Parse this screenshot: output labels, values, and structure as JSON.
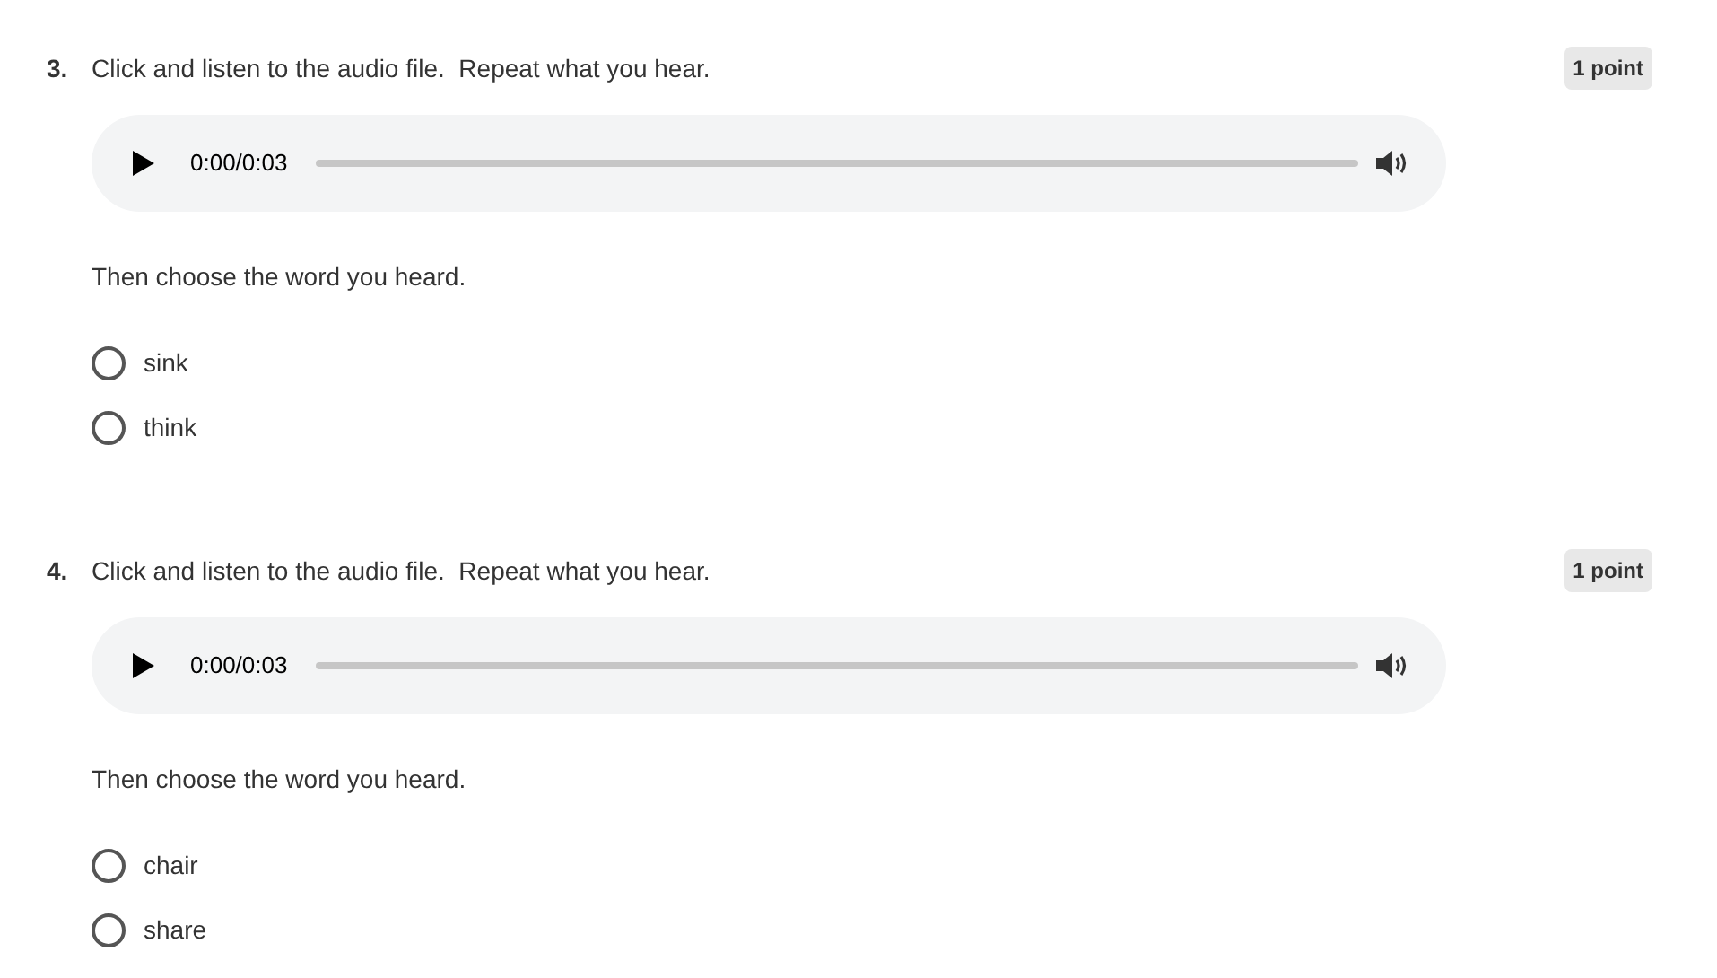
{
  "questions": [
    {
      "number": "3.",
      "text": "Click and listen to the audio file.  Repeat what you hear.",
      "points": "1 point",
      "audio": {
        "time": "0:00/0:03"
      },
      "prompt": "Then choose the word you heard.",
      "options": [
        {
          "label": "sink",
          "selected": false
        },
        {
          "label": "think",
          "selected": false
        }
      ]
    },
    {
      "number": "4.",
      "text": "Click and listen to the audio file.  Repeat what you hear.",
      "points": "1 point",
      "audio": {
        "time": "0:00/0:03"
      },
      "prompt": "Then choose the word you heard.",
      "options": [
        {
          "label": "chair",
          "selected": false
        },
        {
          "label": "share",
          "selected": false
        }
      ]
    }
  ]
}
